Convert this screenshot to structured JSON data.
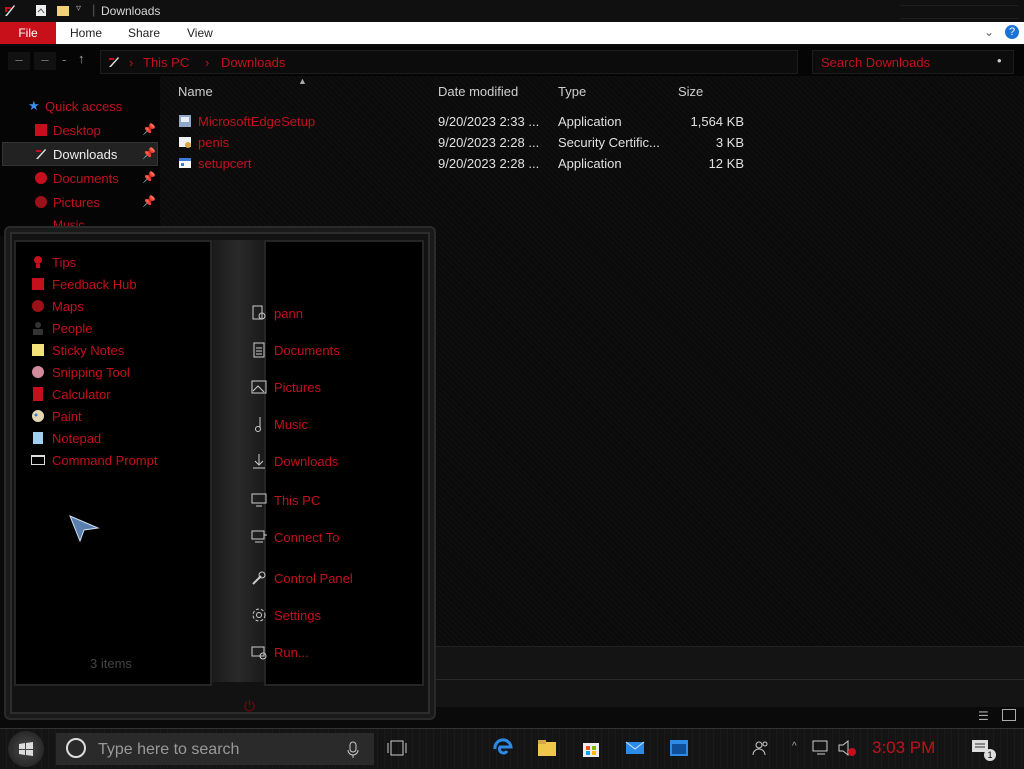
{
  "window": {
    "title": "Downloads"
  },
  "ribbon": {
    "tabs": [
      "File",
      "Home",
      "Share",
      "View"
    ]
  },
  "address": {
    "path": [
      "This PC",
      "Downloads"
    ],
    "search_placeholder": "Search Downloads"
  },
  "nav": {
    "quick_access": "Quick access",
    "items": [
      {
        "label": "Desktop",
        "pinned": true
      },
      {
        "label": "Downloads",
        "pinned": true,
        "selected": true
      },
      {
        "label": "Documents",
        "pinned": true
      },
      {
        "label": "Pictures",
        "pinned": true
      },
      {
        "label": "Music",
        "pinned": false
      }
    ]
  },
  "columns": [
    "Name",
    "Date modified",
    "Type",
    "Size"
  ],
  "files": [
    {
      "name": "MicrosoftEdgeSetup",
      "date": "9/20/2023 2:33 ...",
      "type": "Application",
      "size": "1,564 KB"
    },
    {
      "name": "penis",
      "date": "9/20/2023 2:28 ...",
      "type": "Security Certific...",
      "size": "3 KB"
    },
    {
      "name": "setupcert",
      "date": "9/20/2023 2:28 ...",
      "type": "Application",
      "size": "12 KB"
    }
  ],
  "status": {
    "count": "3 items"
  },
  "start_menu": {
    "apps": [
      "Tips",
      "Feedback Hub",
      "Maps",
      "People",
      "Sticky Notes",
      "Snipping Tool",
      "Calculator",
      "Paint",
      "Notepad",
      "Command Prompt"
    ],
    "places": [
      "pann",
      "Documents",
      "Pictures",
      "Music",
      "Downloads",
      "This PC",
      "Connect To",
      "Control Panel",
      "Settings",
      "Run..."
    ]
  },
  "taskbar": {
    "search_placeholder": "Type here to search",
    "clock": "3:03 PM",
    "notification_count": "1"
  },
  "colors": {
    "accent": "#c4101c",
    "background": "#0a0a0a"
  }
}
